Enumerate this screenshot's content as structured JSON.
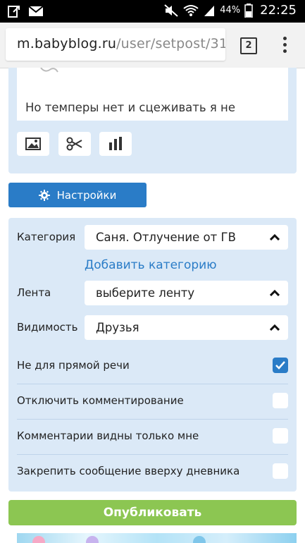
{
  "status_bar": {
    "battery_text": "44%",
    "time": "22:25"
  },
  "browser": {
    "url_host": "m.babyblog.ru",
    "url_path": "/user/setpost/31",
    "tab_count": "2"
  },
  "editor": {
    "text": "Но темперы нет и сцеживать я не стала"
  },
  "settings_button": {
    "label": "Настройки"
  },
  "settings": {
    "category_label": "Категория",
    "category_value": "Саня. Отлучение от ГВ",
    "add_category_label": "Добавить категорию",
    "feed_label": "Лента",
    "feed_value": "выберите ленту",
    "visibility_label": "Видимость",
    "visibility_value": "Друзья",
    "checkboxes": [
      {
        "label": "Не для прямой речи",
        "checked": true
      },
      {
        "label": "Отключить комментирование",
        "checked": false
      },
      {
        "label": "Комментарии видны только мне",
        "checked": false
      },
      {
        "label": "Закрепить сообщение вверху дневника",
        "checked": false
      }
    ]
  },
  "publish_button": {
    "label": "Опубликовать"
  },
  "colors": {
    "accent": "#2a7cc7",
    "panel_bg": "#dbe9f7",
    "publish_green": "#8cc652"
  }
}
